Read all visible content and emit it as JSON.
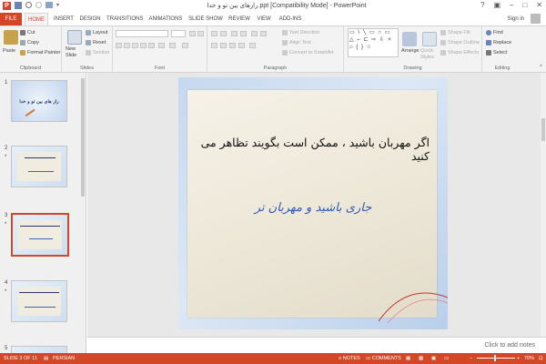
{
  "window": {
    "title": "رازهای بین تو و خدا.ppt [Compatibility Mode] - PowerPoint",
    "app_logo": "P"
  },
  "tabs": [
    "FILE",
    "HOME",
    "INSERT",
    "DESIGN",
    "TRANSITIONS",
    "ANIMATIONS",
    "SLIDE SHOW",
    "REVIEW",
    "VIEW",
    "ADD-INS"
  ],
  "active_tab": "HOME",
  "signin": "Sign in",
  "ribbon": {
    "clipboard": {
      "paste": "Paste",
      "cut": "Cut",
      "copy": "Copy",
      "format_painter": "Format Painter",
      "label": "Clipboard"
    },
    "slides": {
      "new_slide": "New Slide",
      "layout": "Layout",
      "reset": "Reset",
      "section": "Section",
      "label": "Slides"
    },
    "font": {
      "label": "Font"
    },
    "paragraph": {
      "text_direction": "Text Direction",
      "align_text": "Align Text",
      "convert_smartart": "Convert to SmartArt",
      "label": "Paragraph"
    },
    "drawing": {
      "arrange": "Arrange",
      "quick_styles": "Quick Styles",
      "shape_fill": "Shape Fill",
      "shape_outline": "Shape Outline",
      "shape_effects": "Shape Effects",
      "label": "Drawing",
      "shapes_glyphs": "▭ \\ ╲ ▭ ○ ▭ △ ⌐ ⊏ ⇨ ⇩ ✧ ⌂ { } ☆"
    },
    "editing": {
      "find": "Find",
      "replace": "Replace",
      "select": "Select",
      "label": "Editing"
    }
  },
  "thumbnails": [
    {
      "num": "1",
      "star": "",
      "text1": "راز های بین تو و خدا"
    },
    {
      "num": "2",
      "star": "*"
    },
    {
      "num": "3",
      "star": "*",
      "selected": true
    },
    {
      "num": "4",
      "star": "*"
    },
    {
      "num": "5",
      "star": ""
    }
  ],
  "slide": {
    "line1": "اگر مهربان باشید ، ممکن است بگویند تظاهر می کنید",
    "line2": "جاری باشید و مهربان تر"
  },
  "notes_placeholder": "Click to add notes",
  "status": {
    "slide_info": "SLIDE 3 OF 11",
    "language": "PERSIAN",
    "notes": "NOTES",
    "comments": "COMMENTS",
    "zoom": "70%"
  },
  "colors": {
    "accent": "#d24726",
    "slide_title": "#111111",
    "slide_subtitle": "#2f58b8"
  }
}
